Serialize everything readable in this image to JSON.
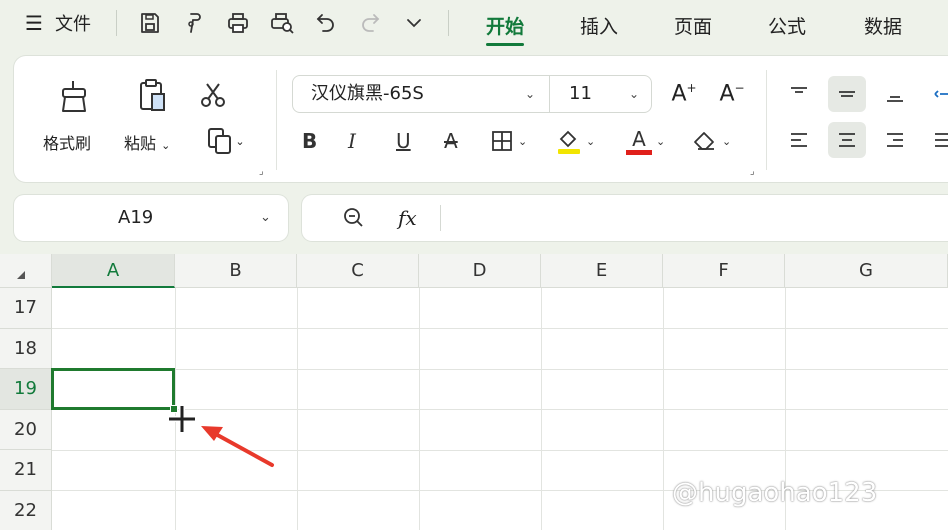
{
  "menubar": {
    "file_label": "文件",
    "tabs": [
      "开始",
      "插入",
      "页面",
      "公式",
      "数据"
    ],
    "active_tab": "开始"
  },
  "ribbon": {
    "format_painter_label": "格式刷",
    "paste_label": "粘贴",
    "font_name": "汉仪旗黑-65S",
    "font_size": "11",
    "bold": "B",
    "italic": "I",
    "underline": "U",
    "strikethrough": "A",
    "font_color_letter": "A",
    "highlight_color": "#f2e500",
    "font_color": "#e0201b"
  },
  "formula": {
    "name_box": "A19",
    "fx_label": "fx"
  },
  "grid": {
    "columns": [
      "A",
      "B",
      "C",
      "D",
      "E",
      "F",
      "G"
    ],
    "rows": [
      "17",
      "18",
      "19",
      "20",
      "21",
      "22"
    ],
    "selected_column": "A",
    "selected_row": "19"
  },
  "colors": {
    "accent": "#127a3b",
    "arrow": "#e8392b"
  },
  "watermark": "@hugaohao123"
}
